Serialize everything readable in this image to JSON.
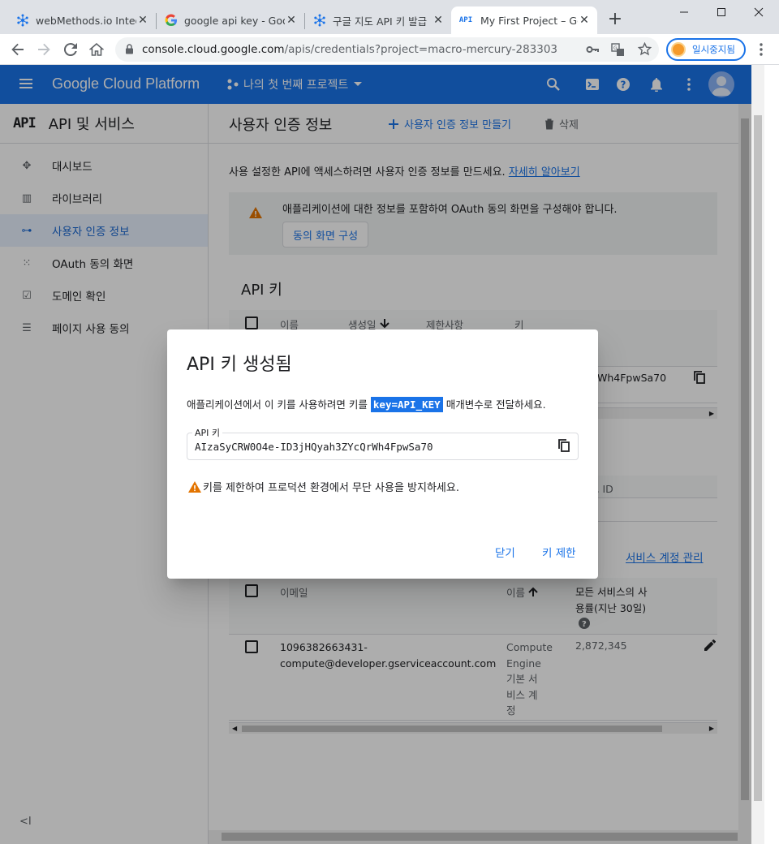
{
  "browser": {
    "tabs": [
      {
        "title": "webMethods.io Integ",
        "favicon": "webmethods-icon"
      },
      {
        "title": "google api key - Goo",
        "favicon": "google-icon"
      },
      {
        "title": "구글 지도 API 키 발급",
        "favicon": "webmethods-icon"
      },
      {
        "title": "My First Project – Go",
        "favicon": "api-icon",
        "favicon_text": "API",
        "active": true
      }
    ],
    "close_glyph": "✕",
    "new_tab_glyph": "+",
    "url_host": "console.cloud.google.com",
    "url_path": "/apis/credentials?project=macro-mercury-283303",
    "profile_label": "일시중지됨"
  },
  "gcp": {
    "brand": "Google Cloud Platform",
    "project": "나의 첫 번째 프로젝트"
  },
  "sidebar": {
    "logo": "API",
    "title": "API 및 서비스",
    "items": [
      {
        "label": "대시보드",
        "icon": "dashboard-icon",
        "glyph": "✥"
      },
      {
        "label": "라이브러리",
        "icon": "library-icon",
        "glyph": "▥"
      },
      {
        "label": "사용자 인증 정보",
        "icon": "key-icon",
        "glyph": "⊶",
        "active": true
      },
      {
        "label": "OAuth 동의 화면",
        "icon": "oauth-icon",
        "glyph": "⁙"
      },
      {
        "label": "도메인 확인",
        "icon": "domain-check-icon",
        "glyph": "☑"
      },
      {
        "label": "페이지 사용 동의",
        "icon": "page-settings-icon",
        "glyph": "☰"
      }
    ],
    "collapse": "<I"
  },
  "main": {
    "title": "사용자 인증 정보",
    "create_label": "사용자 인증 정보 만들기",
    "delete_label": "삭제",
    "intro_text": "사용 설정한 API에 액세스하려면 사용자 인증 정보를 만드세요.",
    "intro_link": "자세히 알아보기",
    "warning_text": "애플리케이션에 대한 정보를 포함하여 OAuth 동의 화면을 구성해야 합니다.",
    "warning_button": "동의 화면 구성",
    "api_keys_title": "API 키",
    "api_table_headers": {
      "name": "이름",
      "created": "생성일",
      "restrictions": "제한사항",
      "key": "키"
    },
    "api_key_partial": "Wh4FpwSa70",
    "oauth_partial_header": "트 ID",
    "service_accounts_link": "서비스 계정 관리",
    "sa_headers": {
      "email": "이메일",
      "name": "이름",
      "usage_line1": "모든 서비스의 사",
      "usage_line2": "용률(지난 30일)"
    },
    "sa_row": {
      "email_line1": "1096382663431-",
      "email_line2": "compute@developer.gserviceaccount.com",
      "name_lines": [
        "Compute",
        "Engine",
        "기본 서",
        "비스 계",
        "정"
      ],
      "usage": "2,872,345"
    }
  },
  "dialog": {
    "title": "API 키 생성됨",
    "desc_before": "애플리케이션에서 이 키를 사용하려면 키를",
    "desc_param": "key=API_KEY",
    "desc_after": "매개변수로 전달하세요.",
    "field_label": "API 키",
    "key_value": "AIzaSyCRW0O4e-ID3jHQyah3ZYcQrWh4FpwSa70",
    "warning": "키를 제한하여 프로덕션 환경에서 무단 사용을 방지하세요.",
    "close_label": "닫기",
    "restrict_label": "키 제한"
  },
  "colors": {
    "accent": "#1a73e8",
    "warning": "#e37400"
  }
}
